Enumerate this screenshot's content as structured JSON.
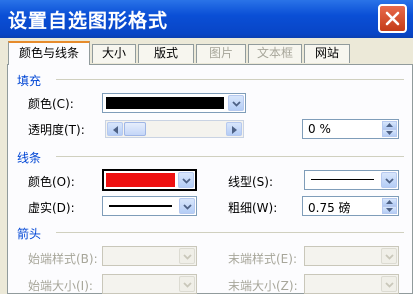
{
  "dialog": {
    "title": "设置自选图形格式"
  },
  "tabs": [
    {
      "label": "颜色与线条",
      "selected": true,
      "enabled": true
    },
    {
      "label": "大小",
      "enabled": true
    },
    {
      "label": "版式",
      "enabled": true
    },
    {
      "label": "图片",
      "enabled": false
    },
    {
      "label": "文本框",
      "enabled": false
    },
    {
      "label": "网站",
      "enabled": true
    }
  ],
  "fill": {
    "section_label": "填充",
    "color_label": "颜色(C):",
    "color_value": "#000000",
    "transparency_label": "透明度(T):",
    "transparency_value": "0 %"
  },
  "line": {
    "section_label": "线条",
    "color_label": "颜色(O):",
    "color_value": "#ee1111",
    "style_label": "线型(S):",
    "dash_label": "虚实(D):",
    "weight_label": "粗细(W):",
    "weight_value": "0.75 磅"
  },
  "arrows": {
    "section_label": "箭头",
    "begin_style_label": "始端样式(B):",
    "end_style_label": "末端样式(E):",
    "begin_size_label": "始端大小(I):",
    "end_size_label": "末端大小(Z):"
  }
}
